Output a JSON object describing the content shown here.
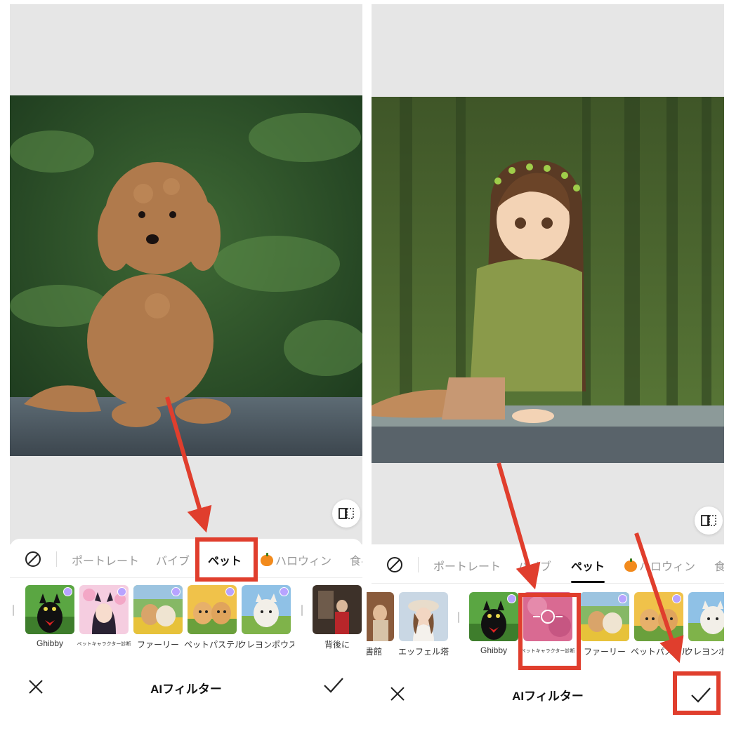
{
  "accent_color": "#e03e2d",
  "screens": [
    {
      "tabs": {
        "none_icon": "no-filter-icon",
        "items": [
          {
            "label": "ポートレート",
            "active": false
          },
          {
            "label": "バイブ",
            "active": false
          },
          {
            "label": "ペット",
            "active": true
          },
          {
            "label": "ハロウィン",
            "active": false,
            "emoji": "pumpkin"
          },
          {
            "label": "食べ",
            "active": false
          }
        ]
      },
      "filters": [
        {
          "label": "Ghibby",
          "premium": true
        },
        {
          "label": "ペットキャラクター診断",
          "premium": true
        },
        {
          "label": "ファーリー",
          "premium": true
        },
        {
          "label": "ペットパステル",
          "premium": true
        },
        {
          "label": "クレヨンポウズ",
          "premium": true
        },
        {
          "label": "背後に",
          "premium": false
        }
      ],
      "bottom_bar": {
        "title": "AIフィルター",
        "close_icon": "close-icon",
        "apply_icon": "checkmark-icon"
      },
      "compare_icon": "compare-icon"
    },
    {
      "tabs": {
        "none_icon": "no-filter-icon",
        "items": [
          {
            "label": "ポートレート",
            "active": false
          },
          {
            "label": "バイブ",
            "active": false
          },
          {
            "label": "ペット",
            "active": true
          },
          {
            "label": "ハロウィン",
            "active": false,
            "emoji": "pumpkin"
          },
          {
            "label": "食べ",
            "active": false
          }
        ]
      },
      "filters": [
        {
          "label": "図書館",
          "premium": false
        },
        {
          "label": "エッフェル塔",
          "premium": false
        },
        {
          "label": "Ghibby",
          "premium": true
        },
        {
          "label": "ペットキャラクター診断",
          "premium": false,
          "selected": true
        },
        {
          "label": "ファーリー",
          "premium": true
        },
        {
          "label": "ペットパステル",
          "premium": true
        },
        {
          "label": "クレヨンポウズ",
          "premium": true
        }
      ],
      "bottom_bar": {
        "title": "AIフィルター",
        "close_icon": "close-icon",
        "apply_icon": "checkmark-icon"
      },
      "compare_icon": "compare-icon"
    }
  ]
}
